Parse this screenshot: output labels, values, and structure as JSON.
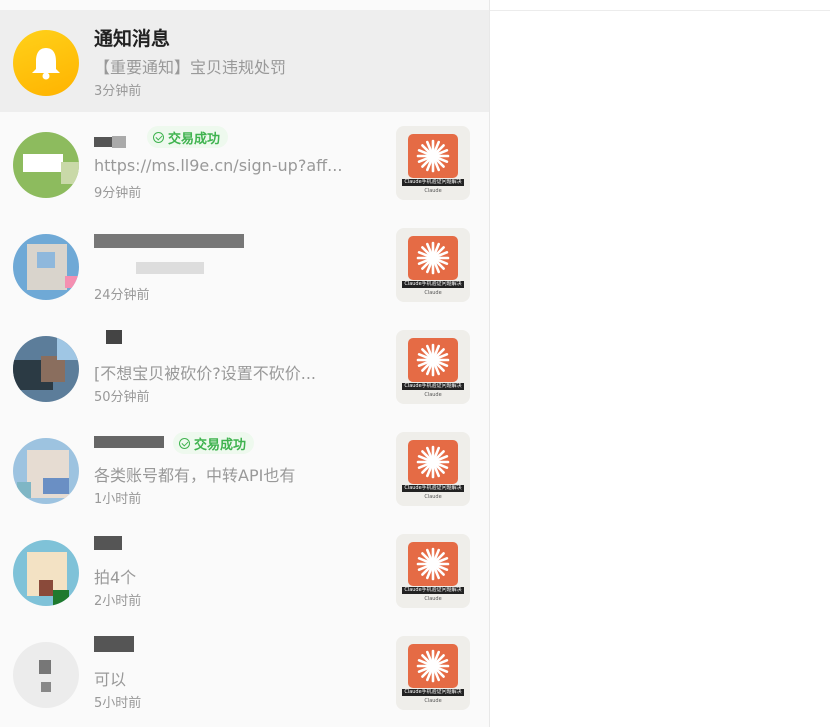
{
  "notification": {
    "title": "通知消息",
    "preview": "【重要通知】宝贝违规处罚",
    "time": "3分钟前",
    "icon": "bell-icon"
  },
  "product_thumb": {
    "strip_text": "Claude手机验证问题解决",
    "caption": "Claude",
    "brand_color": "#e56b45"
  },
  "conversations": [
    {
      "name": "",
      "badge": "交易成功",
      "preview": "https://ms.ll9e.cn/sign-up?aff...",
      "time": "9分钟前"
    },
    {
      "name": "",
      "badge": "",
      "preview": "",
      "time": "24分钟前"
    },
    {
      "name": "",
      "badge": "",
      "preview": "[不想宝贝被砍价?设置不砍价...",
      "time": "50分钟前"
    },
    {
      "name": "",
      "badge": "交易成功",
      "preview": "各类账号都有，中转API也有",
      "time": "1小时前"
    },
    {
      "name": "",
      "badge": "",
      "preview": "拍4个",
      "time": "2小时前"
    },
    {
      "name": "",
      "badge": "",
      "preview": "可以",
      "time": "5小时前"
    }
  ]
}
